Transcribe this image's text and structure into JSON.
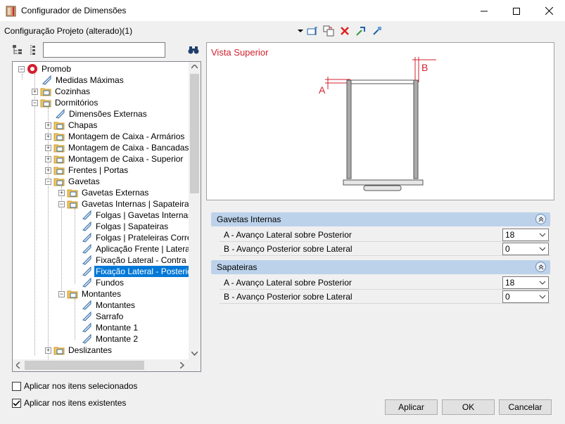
{
  "window": {
    "title": "Configurador de Dimensões"
  },
  "config": {
    "label": "Configuração Projeto (alterado)(1)"
  },
  "search": {
    "value": ""
  },
  "tree": {
    "items": [
      {
        "label": "Promob"
      },
      {
        "label": "Medidas Máximas"
      },
      {
        "label": "Cozinhas"
      },
      {
        "label": "Dormitórios"
      },
      {
        "label": "Dimensões Externas"
      },
      {
        "label": "Chapas"
      },
      {
        "label": "Montagem de Caixa - Armários"
      },
      {
        "label": "Montagem de Caixa - Bancadas | Cr"
      },
      {
        "label": "Montagem de Caixa - Superior"
      },
      {
        "label": "Frentes | Portas"
      },
      {
        "label": "Gavetas"
      },
      {
        "label": "Gavetas Externas"
      },
      {
        "label": "Gavetas Internas | Sapateiras | C"
      },
      {
        "label": "Folgas | Gavetas Internas"
      },
      {
        "label": "Folgas | Sapateiras"
      },
      {
        "label": "Folgas | Prateleiras Corrediç"
      },
      {
        "label": "Aplicação Frente | Lateral"
      },
      {
        "label": "Fixação Lateral - Contra Fre"
      },
      {
        "label": "Fixação Lateral - Posterior"
      },
      {
        "label": "Fundos"
      },
      {
        "label": "Montantes"
      },
      {
        "label": "Montantes"
      },
      {
        "label": "Sarrafo"
      },
      {
        "label": "Montante 1"
      },
      {
        "label": "Montante 2"
      },
      {
        "label": "Deslizantes"
      }
    ]
  },
  "preview": {
    "title": "Vista Superior",
    "label_a": "A",
    "label_b": "B"
  },
  "groups": [
    {
      "title": "Gavetas Internas",
      "rows": [
        {
          "label": "A - Avanço Lateral sobre Posterior",
          "value": "18"
        },
        {
          "label": "B - Avanço Posterior sobre Lateral",
          "value": "0"
        }
      ]
    },
    {
      "title": "Sapateiras",
      "rows": [
        {
          "label": "A - Avanço Lateral sobre Posterior",
          "value": "18"
        },
        {
          "label": "B - Avanço Posterior sobre Lateral",
          "value": "0"
        }
      ]
    }
  ],
  "options": {
    "apply_selected": {
      "label": "Aplicar nos itens selecionados",
      "checked": false
    },
    "apply_existing": {
      "label": "Aplicar nos itens existentes",
      "checked": true
    }
  },
  "buttons": {
    "apply": "Aplicar",
    "ok": "OK",
    "cancel": "Cancelar"
  },
  "colors": {
    "accent": "#0078d7",
    "preview_title": "#d2202e",
    "group_header": "#bcd2ea"
  }
}
